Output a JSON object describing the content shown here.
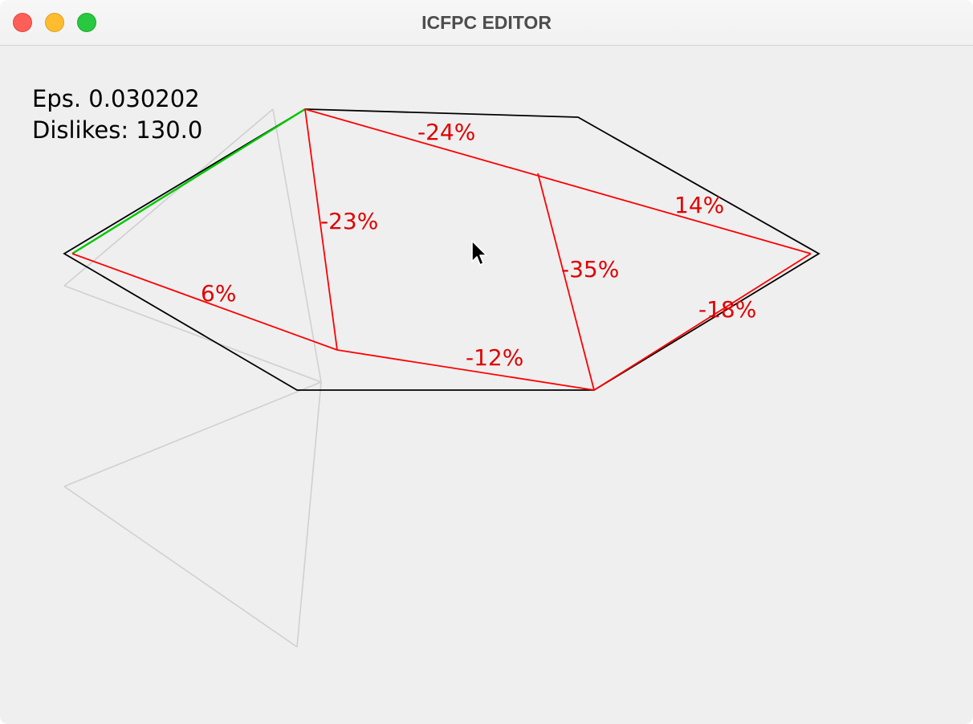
{
  "window": {
    "title": "ICFPC EDITOR",
    "controls": [
      "close",
      "minimize",
      "maximize"
    ]
  },
  "stats": {
    "eps": "Eps. 0.030202",
    "dislikes": "Dislikes: 130.0"
  },
  "edge_labels": [
    "-24%",
    "-23%",
    "14%",
    "-35%",
    "6%",
    "-18%",
    "-12%"
  ],
  "colors": {
    "hole_outline": "#000000",
    "figure_edge_bad": "#ff0000",
    "figure_edge_ok": "#00cc00",
    "ghost_figure": "#cfcfcf",
    "label": "#e00000",
    "background": "#efefef"
  },
  "cursor_icon": "arrow-cursor-icon"
}
